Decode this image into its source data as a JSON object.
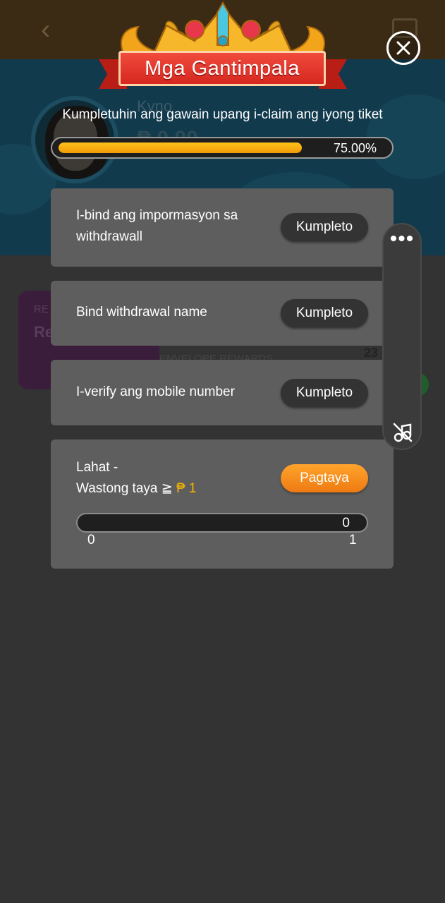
{
  "background": {
    "user_name": "Kyno",
    "balance": "₱ 0.00",
    "card_label_small": "RE",
    "card_label_big": "Re",
    "envelope_text": "ENVELOPE REWARDS",
    "counter": "23"
  },
  "modal": {
    "title": "Mga Gantimpala",
    "subtitle": "Kumpletuhin ang gawain upang i-claim ang iyong tiket",
    "progress": {
      "value": 0.75,
      "label": "75.00%"
    },
    "tasks": [
      {
        "label_line1": "I-bind ang impormasyon sa",
        "label_line2": "withdrawall",
        "button": "Kumpleto"
      },
      {
        "label": "Bind withdrawal name",
        "button": "Kumpleto"
      },
      {
        "label": "I-verify ang mobile number",
        "button": "Kumpleto"
      },
      {
        "label_line1": "Lahat -",
        "label_line2_prefix": "Wastong taya ≧",
        "currency_symbol": "₱",
        "amount": "1",
        "button": "Pagtaya",
        "wager": {
          "current": "0",
          "min_label": "0",
          "max_label": "1",
          "fraction": 0
        }
      }
    ]
  },
  "floating_panel": {
    "menu_label": "•••"
  },
  "colors": {
    "accent_orange": "#f19a08",
    "button_dark": "#333333",
    "card_bg": "#5e5e5e",
    "coin_yellow": "#f7b500",
    "banner_red": "#d6271f"
  },
  "icons": [
    "back-arrow-icon",
    "qr-icon",
    "close-icon",
    "crown-icon",
    "menu-dots-icon",
    "sound-off-icon"
  ]
}
